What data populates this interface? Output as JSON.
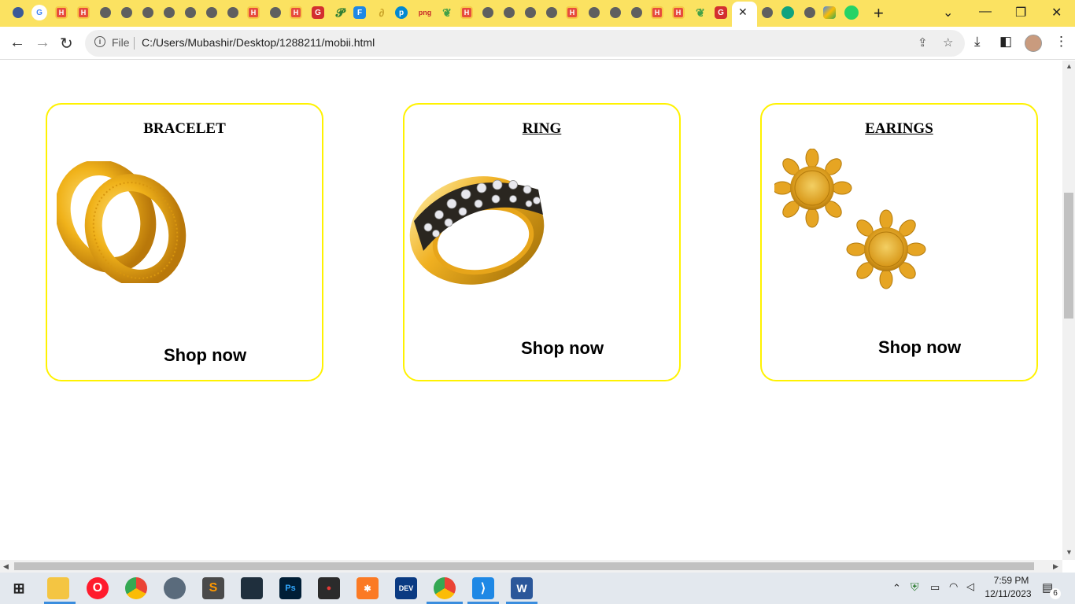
{
  "browser": {
    "tabs_icons": [
      "favicon-f",
      "google",
      "h",
      "h",
      "globe",
      "globe",
      "globe",
      "globe",
      "globe",
      "globe",
      "h",
      "globe",
      "h",
      "g-red",
      "p",
      "f-blue",
      "link",
      "p-blue",
      "png",
      "leaf",
      "h",
      "globe",
      "globe",
      "globe",
      "globe",
      "h",
      "globe",
      "globe",
      "globe",
      "h",
      "h",
      "leaf",
      "g-red",
      "active-close",
      "globe",
      "openai",
      "globe",
      "colorful",
      "whatsapp"
    ],
    "active_tab_close": "✕",
    "new_tab": "+",
    "address": {
      "scheme_label": "File",
      "url": "C:/Users/Mubashir/Desktop/1288211/mobii.html"
    }
  },
  "page": {
    "cards": [
      {
        "title": "BRACELET",
        "cta": "Shop now",
        "image": "gold-bangles"
      },
      {
        "title": "RING",
        "cta": "Shop now",
        "image": "gold-diamond-ring"
      },
      {
        "title": "EARINGS",
        "cta": "Shop now",
        "image": "gold-stud-earrings"
      }
    ]
  },
  "taskbar": {
    "apps": [
      "file-explorer",
      "opera",
      "chrome",
      "media",
      "sublime",
      "app-dark",
      "photoshop",
      "recorder",
      "xampp",
      "dev",
      "chrome-profile",
      "vscode",
      "word"
    ],
    "clock": {
      "time": "7:59 PM",
      "date": "12/11/2023"
    },
    "notifications": "6"
  },
  "colors": {
    "tab_strip": "#fbe261",
    "card_border": "#fff200"
  }
}
